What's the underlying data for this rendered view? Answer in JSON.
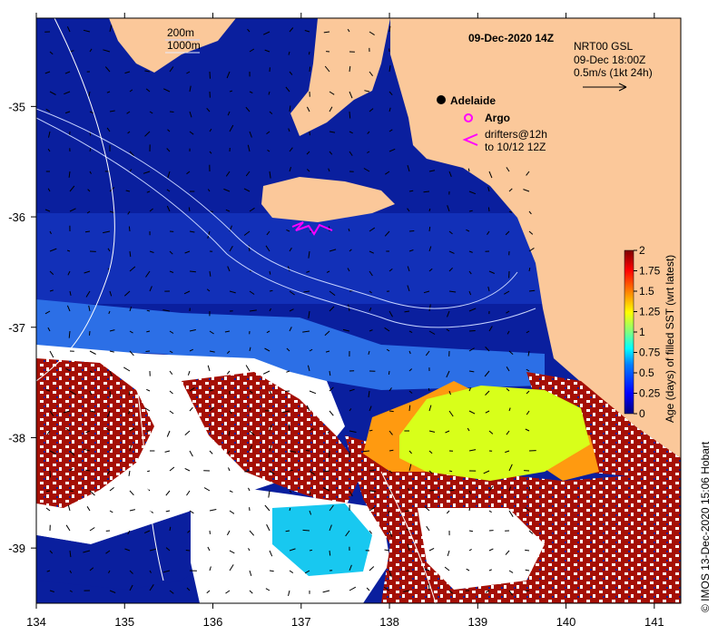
{
  "title": "09-Dec-2020 14Z",
  "product": {
    "name": "NRT00 GSL",
    "time": "09-Dec 18:00Z",
    "scale_text": "0.5m/s (1kt 24h)"
  },
  "depth_contours": [
    "200m",
    "1000m"
  ],
  "places": [
    {
      "name": "Adelaide",
      "lon": 138.6,
      "lat": -34.93
    }
  ],
  "legend": {
    "argo": "Argo",
    "drifters_line1": "drifters@12h",
    "drifters_line2": "to 10/12 12Z",
    "argo_color": "#ff00ff",
    "drifter_color": "#ff00ff"
  },
  "colorbar": {
    "label": "Age (days) of filled SST (wrt latest)",
    "ticks": [
      "0",
      "0.25",
      "0.5",
      "0.75",
      "1",
      "1.25",
      "1.5",
      "1.75",
      "2"
    ],
    "colors": [
      "#00007f",
      "#0000ff",
      "#007fff",
      "#00ffff",
      "#7fff7f",
      "#ffff00",
      "#ff7f00",
      "#ff0000",
      "#7f0000"
    ]
  },
  "axes": {
    "x_ticks": [
      "134",
      "135",
      "136",
      "137",
      "138",
      "139",
      "140",
      "141"
    ],
    "y_ticks": [
      "-35",
      "-36",
      "-37",
      "-38",
      "-39"
    ],
    "xlim": [
      134,
      141.3
    ],
    "ylim": [
      -39.5,
      -34.2
    ]
  },
  "colors": {
    "land": "#fbc89a",
    "ocean_deep": "#0a1f9e",
    "ocean_mid": "#1e4fd0",
    "ocean_light": "#3b8bf0",
    "cloud": "#ffffff",
    "old_data": "#a50f05",
    "yellow_green": "#d8ff1a",
    "orange": "#ff9a10",
    "cyan": "#18c8f0"
  },
  "credit": "© IMOS 13-Dec-2020 15:06 Hobart"
}
